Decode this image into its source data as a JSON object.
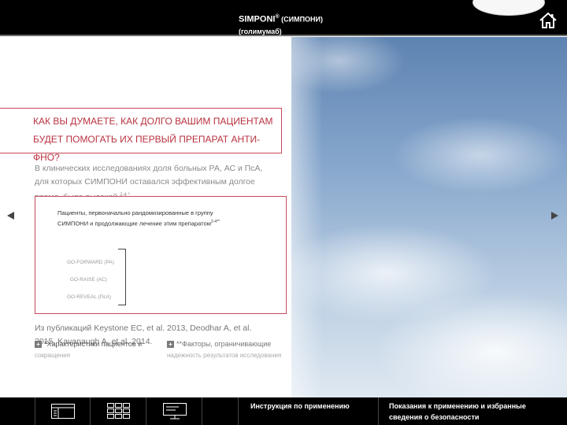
{
  "header": {
    "brand": "SIMPONI",
    "reg": "®",
    "brand_ru": " (СИМПОНИ)",
    "inn": "(голимумаб)"
  },
  "question": {
    "line1": "КАК ВЫ ДУМАЕТЕ, КАК ДОЛГО ВАШИМ ПАЦИЕНТАМ",
    "line2": "БУДЕТ ПОМОГАТЬ ИХ ПЕРВЫЙ ПРЕПАРАТ АНТИ-ФНО?"
  },
  "intro": {
    "text": "В клинических исследованиях доля больных РА, АС и ПсА, для которых СИМПОНИ оставался эффективным долгое время, была высокой.",
    "sup": "2-4 *"
  },
  "results": {
    "heading": "Пациенты, первоначально рандомизированные в группу СИМПОНИ и продолжающие лечение этим препаратом",
    "heading_sup": "2-4**",
    "studies": [
      "GO-FORWARD (РА)",
      "GO-RAISE (АС)",
      "GO-REVEAL (ПсА)"
    ]
  },
  "reference": {
    "text": "Из публикаций Keystone EC, et al. 2013, Deodhar A, et al. 2015, Kavanaugh A, et al. 2014."
  },
  "expanders": [
    {
      "icon": "plus-icon",
      "label": "*Характеристики пациентов и",
      "wrap": "сокращения"
    },
    {
      "icon": "plus-icon",
      "label": "**Факторы, ограничивающие",
      "wrap": "надежность результатов исследования"
    }
  ],
  "bottom_nav": {
    "instructions": "Инструкция по применению",
    "indications": "Показания к применению и избранные сведения о безопасности"
  },
  "icons": {
    "home": "home-icon",
    "prev": "arrow-left-icon",
    "next": "arrow-right-icon",
    "list_view": "list-view-icon",
    "grid_view": "grid-view-icon",
    "presentation": "presentation-icon"
  },
  "colors": {
    "accent": "#b8323f",
    "border": "#c74a5a",
    "bar": "#000000"
  }
}
